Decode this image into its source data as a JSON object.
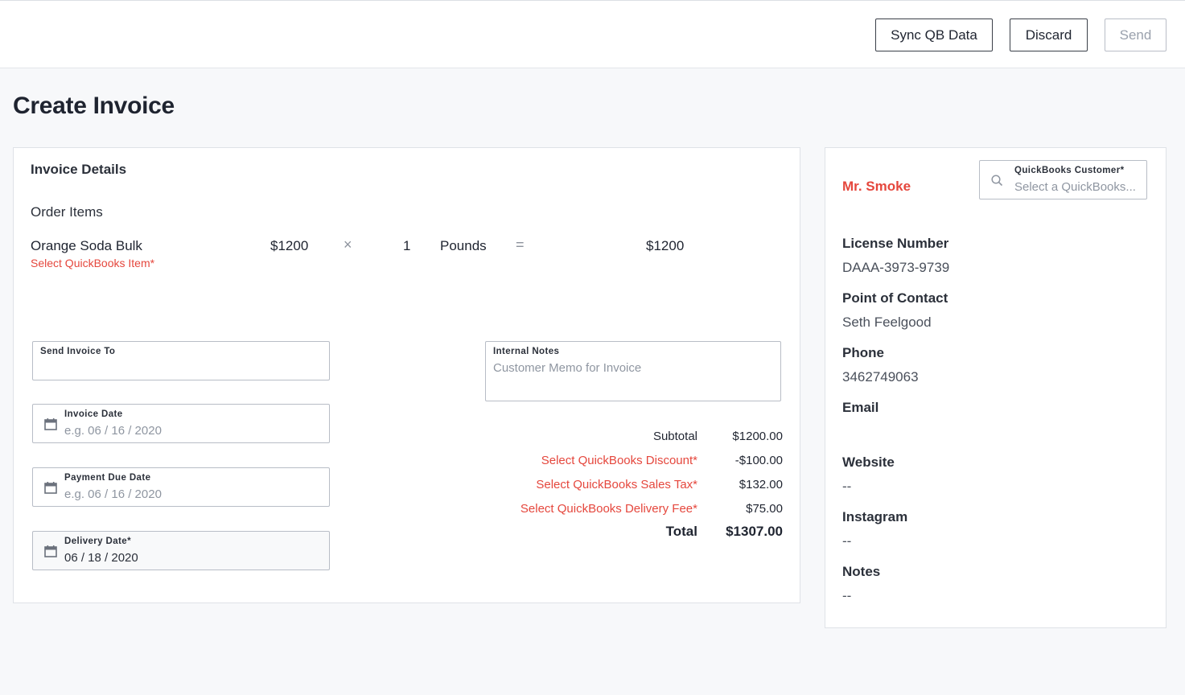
{
  "toolbar": {
    "sync_label": "Sync QB Data",
    "discard_label": "Discard",
    "send_label": "Send"
  },
  "page": {
    "title": "Create Invoice"
  },
  "invoice": {
    "section_title": "Invoice Details",
    "order_items_title": "Order Items",
    "items": [
      {
        "name": "Orange Soda Bulk",
        "qb_item_prompt": "Select QuickBooks Item*",
        "price": "$1200",
        "times_symbol": "×",
        "quantity": "1",
        "unit": "Pounds",
        "equals_symbol": "=",
        "line_total": "$1200"
      }
    ],
    "send_to": {
      "label": "Send Invoice To",
      "value": ""
    },
    "invoice_date": {
      "label": "Invoice Date",
      "placeholder": "e.g. 06 / 16 / 2020"
    },
    "payment_due_date": {
      "label": "Payment Due Date",
      "placeholder": "e.g. 06 / 16 / 2020"
    },
    "delivery_date": {
      "label": "Delivery Date*",
      "value": "06 / 18 / 2020"
    },
    "internal_notes": {
      "label": "Internal Notes",
      "placeholder": "Customer Memo for Invoice"
    },
    "totals": {
      "subtotal_label": "Subtotal",
      "subtotal_value": "$1200.00",
      "discount_label": "Select QuickBooks Discount*",
      "discount_value": "-$100.00",
      "tax_label": "Select QuickBooks Sales Tax*",
      "tax_value": "$132.00",
      "delivery_label": "Select QuickBooks Delivery Fee*",
      "delivery_value": "$75.00",
      "total_label": "Total",
      "total_value": "$1307.00"
    }
  },
  "customer": {
    "name": "Mr. Smoke",
    "qb_customer": {
      "label": "QuickBooks Customer*",
      "placeholder": "Select a QuickBooks..."
    },
    "fields": [
      {
        "label": "License Number",
        "value": "DAAA-3973-9739"
      },
      {
        "label": "Point of Contact",
        "value": "Seth Feelgood"
      },
      {
        "label": "Phone",
        "value": "3462749063"
      },
      {
        "label": "Email",
        "value": ""
      },
      {
        "label": "Website",
        "value": "--"
      },
      {
        "label": "Instagram",
        "value": "--"
      },
      {
        "label": "Notes",
        "value": "--"
      }
    ]
  },
  "icons": {
    "calendar": "calendar-icon",
    "search": "search-icon"
  },
  "colors": {
    "accent_red": "#e5473d",
    "text_dark": "#1f2430",
    "border": "#b8bdc6"
  }
}
